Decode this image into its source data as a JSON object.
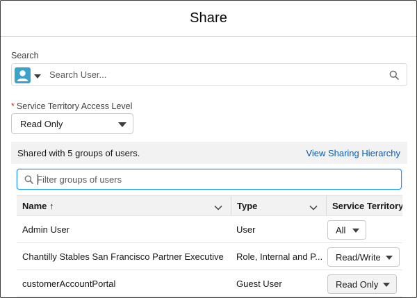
{
  "dialog": {
    "title": "Share"
  },
  "search": {
    "label": "Search",
    "placeholder": "Search User..."
  },
  "access_level": {
    "label": "Service Territory Access Level",
    "required_marker": "*",
    "selected": "Read Only"
  },
  "shared": {
    "summary": "Shared with 5 groups of users.",
    "hierarchy_link": "View Sharing Hierarchy"
  },
  "filter": {
    "placeholder": "Filter groups of users"
  },
  "table": {
    "columns": [
      {
        "label": "Name",
        "sort_indicator": "↑"
      },
      {
        "label": "Type"
      },
      {
        "label": "Service Territory"
      }
    ],
    "rows": [
      {
        "name": "Admin User",
        "type": "User",
        "access": "All"
      },
      {
        "name": "Chantilly Stables San Francisco Partner Executive",
        "type": "Role, Internal and P...",
        "access": "Read/Write"
      },
      {
        "name": "customerAccountPortal",
        "type": "Guest User",
        "access": "Read Only"
      }
    ]
  },
  "colors": {
    "link": "#0b5cab",
    "focus_border": "#1b96ff",
    "avatar_bg": "#3ba3c9",
    "required": "#c23934",
    "bar_bg": "#f3f2f2"
  },
  "icons": [
    "user-avatar-icon",
    "chevron-down-icon",
    "search-icon",
    "sort-up-icon"
  ]
}
